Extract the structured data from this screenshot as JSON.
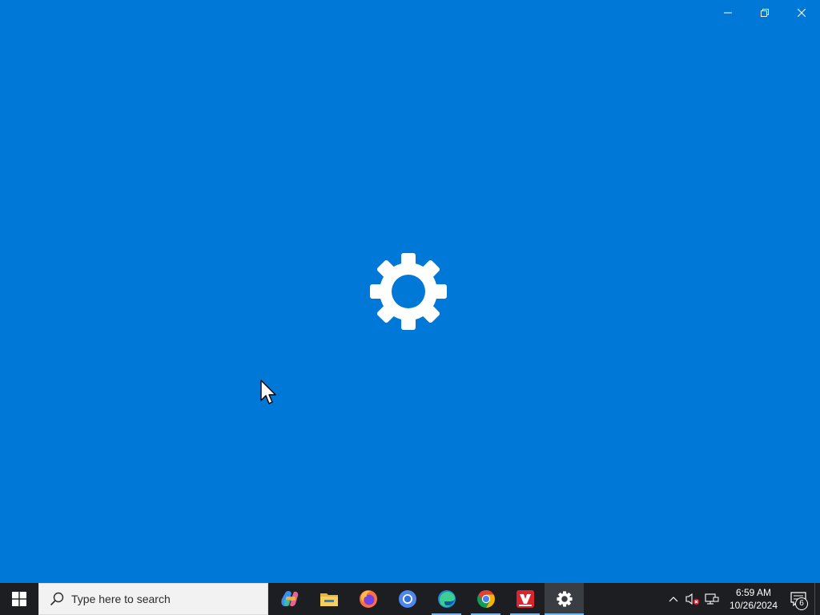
{
  "window": {
    "app": "Settings",
    "caption_buttons": [
      "minimize",
      "restore",
      "close"
    ],
    "splash_icon": "gear-icon",
    "background_color": "#0078d7"
  },
  "taskbar": {
    "search_placeholder": "Type here to search",
    "apps": [
      {
        "name": "copilot",
        "icon": "copilot-icon",
        "running": false
      },
      {
        "name": "file-explorer",
        "icon": "folder-icon",
        "running": false
      },
      {
        "name": "firefox",
        "icon": "firefox-icon",
        "running": false
      },
      {
        "name": "chromium",
        "icon": "chromium-icon",
        "running": false
      },
      {
        "name": "edge",
        "icon": "edge-icon",
        "running": true
      },
      {
        "name": "chrome",
        "icon": "chrome-icon",
        "running": true
      },
      {
        "name": "vivaldi",
        "icon": "vivaldi-icon",
        "running": true
      },
      {
        "name": "settings",
        "icon": "gear-icon",
        "running": true,
        "active": true
      }
    ],
    "tray": {
      "time": "6:59 AM",
      "date": "10/26/2024",
      "notification_count": "6"
    },
    "background_color": "#1c1e22"
  }
}
